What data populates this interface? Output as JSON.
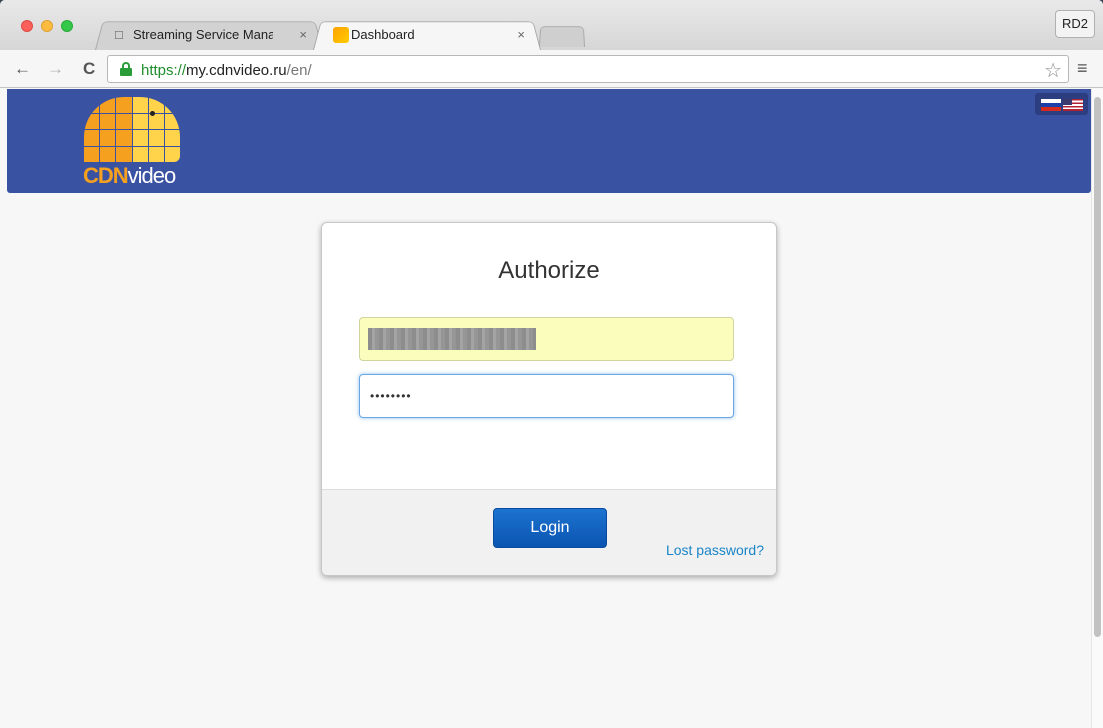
{
  "browser": {
    "tabs": [
      {
        "label": "Streaming Service Manage",
        "icon": "page-icon",
        "active": false
      },
      {
        "label": "Dashboard",
        "icon": "cdnvideo-favicon",
        "active": true
      }
    ],
    "tab_close_glyph": "×",
    "profile": "RD2",
    "url": {
      "scheme": "https://",
      "host": "my.cdnvideo.ru",
      "path": "/en/"
    },
    "nav": {
      "back": "←",
      "forward": "→",
      "reload": "C",
      "star": "☆",
      "menu": "≡"
    }
  },
  "header": {
    "logo": {
      "cdn": "CDN",
      "video": "video"
    },
    "languages": [
      "ru",
      "en"
    ],
    "brand_color": "#3a52a2",
    "logo_color": "#f6a020"
  },
  "auth": {
    "title": "Authorize",
    "username_value": "",
    "password_value": "••••••••",
    "login_label": "Login",
    "lost_password": "Lost password?",
    "button_color": "#0b5fc0",
    "link_color": "#1a85c7"
  }
}
